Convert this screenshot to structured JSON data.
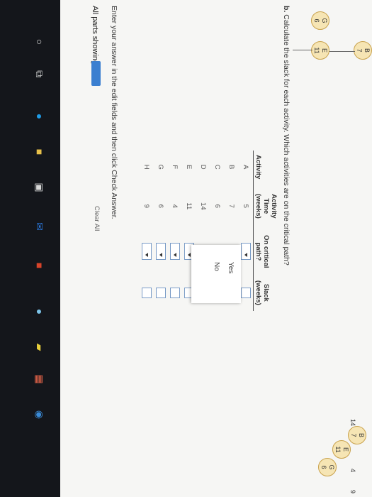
{
  "graph_top": {
    "nodes": [
      {
        "letter": "B",
        "value": "7"
      },
      {
        "letter": "E",
        "value": "11"
      },
      {
        "letter": "G",
        "value": "6"
      }
    ]
  },
  "graph_bottom": {
    "numbers": [
      "14",
      "4",
      "9"
    ],
    "nodes": [
      {
        "letter": "B",
        "value": "7"
      },
      {
        "letter": "E",
        "value": "11"
      },
      {
        "letter": "G",
        "value": "6"
      }
    ]
  },
  "question": {
    "label": "b.",
    "text": "Calculate the slack for each activity. Which activities are on the critical path?"
  },
  "table": {
    "headers": {
      "activity": "Activity",
      "time": "Activity Time (weeks)",
      "critical": "On critical path?",
      "slack": "Slack (weeks)"
    },
    "rows": [
      {
        "activity": "A",
        "time": "5"
      },
      {
        "activity": "B",
        "time": "7"
      },
      {
        "activity": "C",
        "time": "6"
      },
      {
        "activity": "D",
        "time": "14"
      },
      {
        "activity": "E",
        "time": "11"
      },
      {
        "activity": "F",
        "time": "4"
      },
      {
        "activity": "G",
        "time": "6"
      },
      {
        "activity": "H",
        "time": "9"
      }
    ]
  },
  "dropdown_options": [
    "Yes",
    "No"
  ],
  "instructions": "Enter your answer in the edit fields and then click Check Answer.",
  "parts_showing": "All parts showing",
  "clear_all": "Clear All",
  "taskbar": {
    "icons": [
      "search-circle-icon",
      "task-view-icon",
      "edge-icon",
      "file-explorer-icon",
      "store-icon",
      "mail-icon",
      "office-icon",
      "paint-icon",
      "sticky-icon",
      "calendar-icon",
      "chrome-icon"
    ]
  },
  "colors": {
    "accent": "#3b7fd0",
    "node_fill": "#f6e5b4"
  }
}
